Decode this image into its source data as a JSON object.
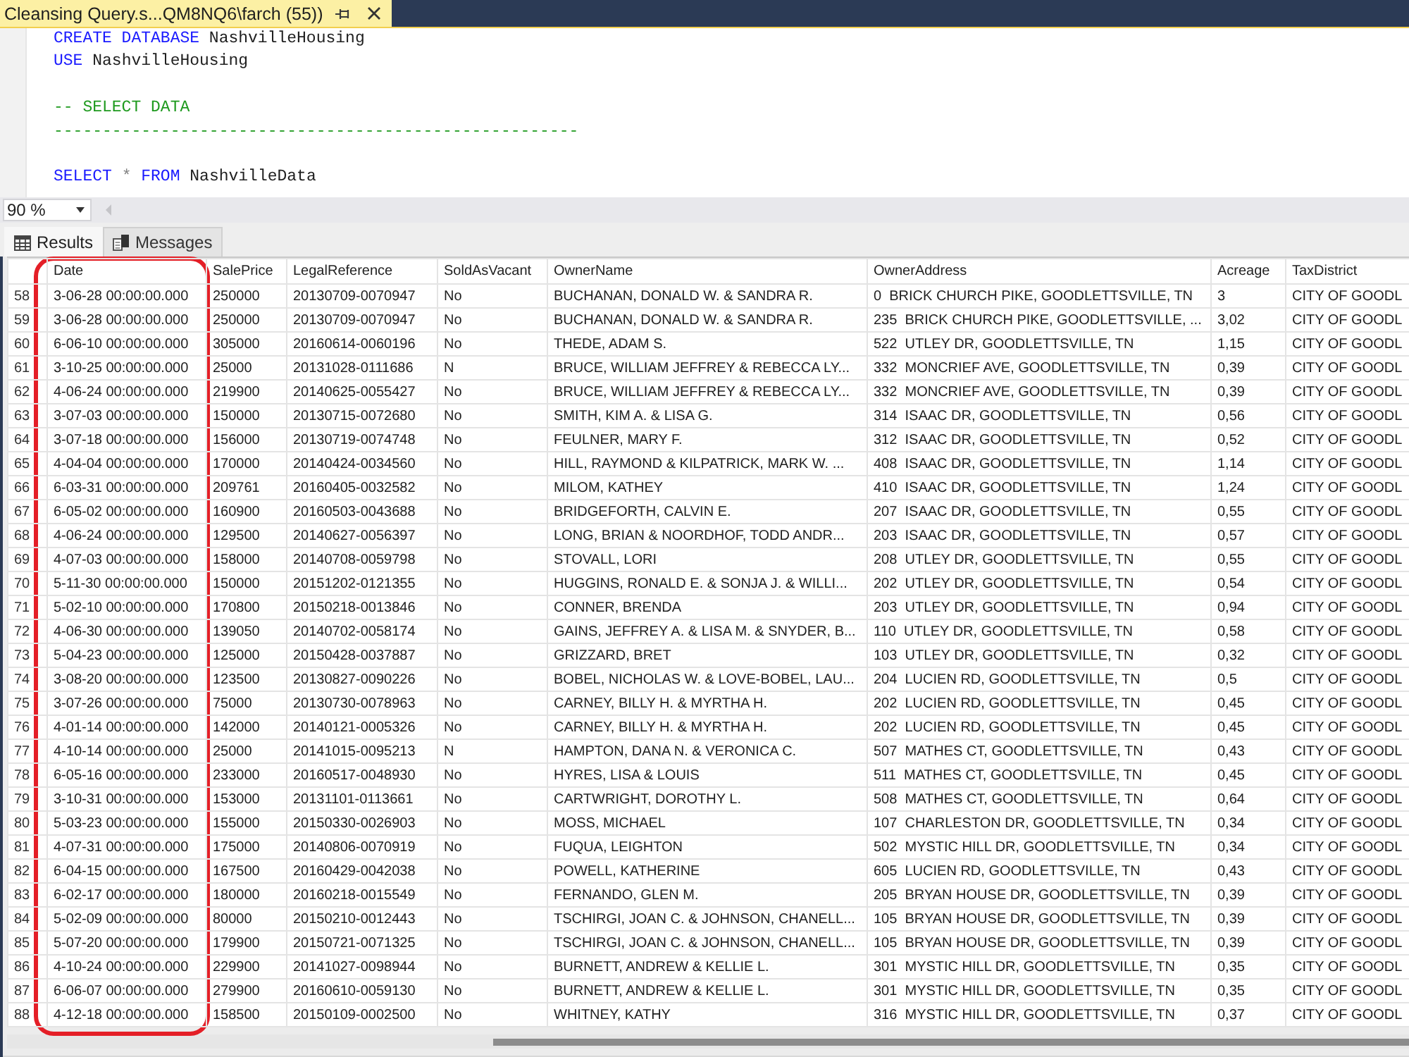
{
  "document_tab": {
    "title": "Cleansing Query.s...QM8NQ6\\farch (55))",
    "selected": true
  },
  "editor": {
    "blocks": [
      {
        "lines": [
          {
            "tokens": [
              {
                "text": "CREATE DATABASE ",
                "kind": "keyword"
              },
              {
                "text": "NashvilleHousing",
                "kind": "identifier"
              }
            ]
          },
          {
            "tokens": [
              {
                "text": "USE ",
                "kind": "keyword"
              },
              {
                "text": "NashvilleHousing",
                "kind": "identifier"
              }
            ]
          }
        ]
      },
      {
        "lines": [
          {
            "tokens": [
              {
                "text": "-- SELECT DATA",
                "kind": "comment"
              }
            ]
          },
          {
            "tokens": [
              {
                "text": "------------------------------------------------------",
                "kind": "comment"
              }
            ]
          }
        ]
      },
      {
        "lines": [
          {
            "tokens": [
              {
                "text": "SELECT ",
                "kind": "keyword"
              },
              {
                "text": "* ",
                "kind": "operator"
              },
              {
                "text": "FROM ",
                "kind": "keyword"
              },
              {
                "text": "NashvilleData",
                "kind": "identifier"
              }
            ]
          }
        ]
      }
    ]
  },
  "zoom": {
    "value": "90 %"
  },
  "results_tabs": [
    {
      "label": "Results",
      "kind": "grid",
      "selected": true
    },
    {
      "label": "Messages",
      "kind": "messages",
      "selected": false
    }
  ],
  "table": {
    "columns": [
      {
        "label": "Date",
        "highlighted": true
      },
      {
        "label": "SalePrice",
        "highlighted": false
      },
      {
        "label": "LegalReference",
        "highlighted": false
      },
      {
        "label": "SoldAsVacant",
        "highlighted": false
      },
      {
        "label": "OwnerName",
        "highlighted": false
      },
      {
        "label": "OwnerAddress",
        "highlighted": false
      },
      {
        "label": "Acreage",
        "highlighted": false
      },
      {
        "label": "TaxDistrict",
        "highlighted": false
      }
    ],
    "rows": [
      {
        "number": "58",
        "cells": [
          "3-06-28 00:00:00.000",
          "250000",
          "20130709-0070947",
          "No",
          "BUCHANAN, DONALD W. & SANDRA R.",
          "0  BRICK CHURCH PIKE, GOODLETTSVILLE, TN",
          "3",
          "CITY OF GOODL"
        ]
      },
      {
        "number": "59",
        "cells": [
          "3-06-28 00:00:00.000",
          "250000",
          "20130709-0070947",
          "No",
          "BUCHANAN, DONALD W. & SANDRA R.",
          "235  BRICK CHURCH PIKE, GOODLETTSVILLE, ...",
          "3,02",
          "CITY OF GOODL"
        ]
      },
      {
        "number": "60",
        "cells": [
          "6-06-10 00:00:00.000",
          "305000",
          "20160614-0060196",
          "No",
          "THEDE, ADAM S.",
          "522  UTLEY DR, GOODLETTSVILLE, TN",
          "1,15",
          "CITY OF GOODL"
        ]
      },
      {
        "number": "61",
        "cells": [
          "3-10-25 00:00:00.000",
          "25000",
          "20131028-0111686",
          "N",
          "BRUCE, WILLIAM JEFFREY & REBECCA LY...",
          "332  MONCRIEF AVE, GOODLETTSVILLE, TN",
          "0,39",
          "CITY OF GOODL"
        ]
      },
      {
        "number": "62",
        "cells": [
          "4-06-24 00:00:00.000",
          "219900",
          "20140625-0055427",
          "No",
          "BRUCE, WILLIAM JEFFREY & REBECCA LY...",
          "332  MONCRIEF AVE, GOODLETTSVILLE, TN",
          "0,39",
          "CITY OF GOODL"
        ]
      },
      {
        "number": "63",
        "cells": [
          "3-07-03 00:00:00.000",
          "150000",
          "20130715-0072680",
          "No",
          "SMITH, KIM A. & LISA G.",
          "314  ISAAC DR, GOODLETTSVILLE, TN",
          "0,56",
          "CITY OF GOODL"
        ]
      },
      {
        "number": "64",
        "cells": [
          "3-07-18 00:00:00.000",
          "156000",
          "20130719-0074748",
          "No",
          "FEULNER, MARY F.",
          "312  ISAAC DR, GOODLETTSVILLE, TN",
          "0,52",
          "CITY OF GOODL"
        ]
      },
      {
        "number": "65",
        "cells": [
          "4-04-04 00:00:00.000",
          "170000",
          "20140424-0034560",
          "No",
          "HILL, RAYMOND & KILPATRICK, MARK W. ...",
          "408  ISAAC DR, GOODLETTSVILLE, TN",
          "1,14",
          "CITY OF GOODL"
        ]
      },
      {
        "number": "66",
        "cells": [
          "6-03-31 00:00:00.000",
          "209761",
          "20160405-0032582",
          "No",
          "MILOM, KATHEY",
          "410  ISAAC DR, GOODLETTSVILLE, TN",
          "1,24",
          "CITY OF GOODL"
        ]
      },
      {
        "number": "67",
        "cells": [
          "6-05-02 00:00:00.000",
          "160900",
          "20160503-0043688",
          "No",
          "BRIDGEFORTH, CALVIN E.",
          "207  ISAAC DR, GOODLETTSVILLE, TN",
          "0,55",
          "CITY OF GOODL"
        ]
      },
      {
        "number": "68",
        "cells": [
          "4-06-24 00:00:00.000",
          "129500",
          "20140627-0056397",
          "No",
          "LONG, BRIAN & NOORDHOF, TODD ANDR...",
          "203  ISAAC DR, GOODLETTSVILLE, TN",
          "0,57",
          "CITY OF GOODL"
        ]
      },
      {
        "number": "69",
        "cells": [
          "4-07-03 00:00:00.000",
          "158000",
          "20140708-0059798",
          "No",
          "STOVALL, LORI",
          "208  UTLEY DR, GOODLETTSVILLE, TN",
          "0,55",
          "CITY OF GOODL"
        ]
      },
      {
        "number": "70",
        "cells": [
          "5-11-30 00:00:00.000",
          "150000",
          "20151202-0121355",
          "No",
          "HUGGINS, RONALD E. & SONJA J. & WILLI...",
          "202  UTLEY DR, GOODLETTSVILLE, TN",
          "0,54",
          "CITY OF GOODL"
        ]
      },
      {
        "number": "71",
        "cells": [
          "5-02-10 00:00:00.000",
          "170800",
          "20150218-0013846",
          "No",
          "CONNER, BRENDA",
          "203  UTLEY DR, GOODLETTSVILLE, TN",
          "0,94",
          "CITY OF GOODL"
        ]
      },
      {
        "number": "72",
        "cells": [
          "4-06-30 00:00:00.000",
          "139050",
          "20140702-0058174",
          "No",
          "GAINS, JEFFREY A. & LISA M. & SNYDER, B...",
          "110  UTLEY DR, GOODLETTSVILLE, TN",
          "0,58",
          "CITY OF GOODL"
        ]
      },
      {
        "number": "73",
        "cells": [
          "5-04-23 00:00:00.000",
          "125000",
          "20150428-0037887",
          "No",
          "GRIZZARD, BRET",
          "103  UTLEY DR, GOODLETTSVILLE, TN",
          "0,32",
          "CITY OF GOODL"
        ]
      },
      {
        "number": "74",
        "cells": [
          "3-08-20 00:00:00.000",
          "123500",
          "20130827-0090226",
          "No",
          "BOBEL, NICHOLAS W. & LOVE-BOBEL, LAU...",
          "204  LUCIEN RD, GOODLETTSVILLE, TN",
          "0,5",
          "CITY OF GOODL"
        ]
      },
      {
        "number": "75",
        "cells": [
          "3-07-26 00:00:00.000",
          "75000",
          "20130730-0078963",
          "No",
          "CARNEY, BILLY H. & MYRTHA H.",
          "202  LUCIEN RD, GOODLETTSVILLE, TN",
          "0,45",
          "CITY OF GOODL"
        ]
      },
      {
        "number": "76",
        "cells": [
          "4-01-14 00:00:00.000",
          "142000",
          "20140121-0005326",
          "No",
          "CARNEY, BILLY H. & MYRTHA H.",
          "202  LUCIEN RD, GOODLETTSVILLE, TN",
          "0,45",
          "CITY OF GOODL"
        ]
      },
      {
        "number": "77",
        "cells": [
          "4-10-14 00:00:00.000",
          "25000",
          "20141015-0095213",
          "N",
          "HAMPTON, DANA N. & VERONICA C.",
          "507  MATHES CT, GOODLETTSVILLE, TN",
          "0,43",
          "CITY OF GOODL"
        ]
      },
      {
        "number": "78",
        "cells": [
          "6-05-16 00:00:00.000",
          "233000",
          "20160517-0048930",
          "No",
          "HYRES, LISA & LOUIS",
          "511  MATHES CT, GOODLETTSVILLE, TN",
          "0,45",
          "CITY OF GOODL"
        ]
      },
      {
        "number": "79",
        "cells": [
          "3-10-31 00:00:00.000",
          "153000",
          "20131101-0113661",
          "No",
          "CARTWRIGHT, DOROTHY L.",
          "508  MATHES CT, GOODLETTSVILLE, TN",
          "0,64",
          "CITY OF GOODL"
        ]
      },
      {
        "number": "80",
        "cells": [
          "5-03-23 00:00:00.000",
          "155000",
          "20150330-0026903",
          "No",
          "MOSS, MICHAEL",
          "107  CHARLESTON DR, GOODLETTSVILLE, TN",
          "0,34",
          "CITY OF GOODL"
        ]
      },
      {
        "number": "81",
        "cells": [
          "4-07-31 00:00:00.000",
          "175000",
          "20140806-0070919",
          "No",
          "FUQUA, LEIGHTON",
          "502  MYSTIC HILL DR, GOODLETTSVILLE, TN",
          "0,34",
          "CITY OF GOODL"
        ]
      },
      {
        "number": "82",
        "cells": [
          "6-04-15 00:00:00.000",
          "167500",
          "20160429-0042038",
          "No",
          "POWELL, KATHERINE",
          "605  LUCIEN RD, GOODLETTSVILLE, TN",
          "0,43",
          "CITY OF GOODL"
        ]
      },
      {
        "number": "83",
        "cells": [
          "6-02-17 00:00:00.000",
          "180000",
          "20160218-0015549",
          "No",
          "FERNANDO, GLEN M.",
          "205  BRYAN HOUSE DR, GOODLETTSVILLE, TN",
          "0,39",
          "CITY OF GOODL"
        ]
      },
      {
        "number": "84",
        "cells": [
          "5-02-09 00:00:00.000",
          "80000",
          "20150210-0012443",
          "No",
          "TSCHIRGI, JOAN C. & JOHNSON, CHANELL...",
          "105  BRYAN HOUSE DR, GOODLETTSVILLE, TN",
          "0,39",
          "CITY OF GOODL"
        ]
      },
      {
        "number": "85",
        "cells": [
          "5-07-20 00:00:00.000",
          "179900",
          "20150721-0071325",
          "No",
          "TSCHIRGI, JOAN C. & JOHNSON, CHANELL...",
          "105  BRYAN HOUSE DR, GOODLETTSVILLE, TN",
          "0,39",
          "CITY OF GOODL"
        ]
      },
      {
        "number": "86",
        "cells": [
          "4-10-24 00:00:00.000",
          "229900",
          "20141027-0098944",
          "No",
          "BURNETT, ANDREW & KELLIE L.",
          "301  MYSTIC HILL DR, GOODLETTSVILLE, TN",
          "0,35",
          "CITY OF GOODL"
        ]
      },
      {
        "number": "87",
        "cells": [
          "6-06-07 00:00:00.000",
          "279900",
          "20160610-0059130",
          "No",
          "BURNETT, ANDREW & KELLIE L.",
          "301  MYSTIC HILL DR, GOODLETTSVILLE, TN",
          "0,35",
          "CITY OF GOODL"
        ]
      },
      {
        "number": "88",
        "cells": [
          "4-12-18 00:00:00.000",
          "158500",
          "20150109-0002500",
          "No",
          "WHITNEY, KATHY",
          "316  MYSTIC HILL DR, GOODLETTSVILLE, TN",
          "0,37",
          "CITY OF GOODL"
        ]
      }
    ]
  }
}
